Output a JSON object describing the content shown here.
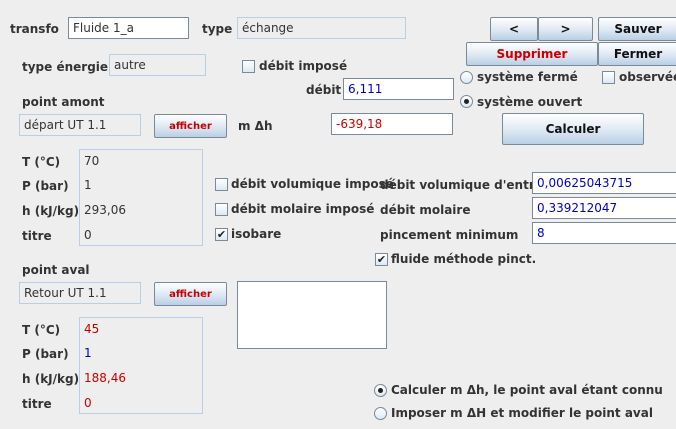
{
  "header": {
    "transfo_label": "transfo",
    "transfo_value": "Fluide 1_a",
    "type_label": "type",
    "type_value": "échange"
  },
  "nav": {
    "prev_label": "<",
    "next_label": ">",
    "save_label": "Sauver",
    "delete_label": "Supprimer",
    "close_label": "Fermer"
  },
  "energy": {
    "label": "type énergie",
    "value": "autre"
  },
  "flow": {
    "debit_impose_label": "débit imposé",
    "debit_label": "débit",
    "debit_value": "6,111",
    "m_dh_label": "m Δh",
    "m_dh_value": "-639,18"
  },
  "system": {
    "closed_label": "système fermé",
    "open_label": "système ouvert",
    "observed_label": "observée",
    "calc_label": "Calculer",
    "selected": "open"
  },
  "amont": {
    "title": "point amont",
    "name_value": "départ UT 1.1",
    "show_label": "afficher",
    "t_label": "T (°C)",
    "t_value": "70",
    "p_label": "P (bar)",
    "p_value": "1",
    "h_label": "h (kJ/kg)",
    "h_value": "293,06",
    "titre_label": "titre",
    "titre_value": "0"
  },
  "options": {
    "vol_impose_label": "débit volumique imposé",
    "mol_impose_label": "débit molaire imposé",
    "isobare_label": "isobare",
    "isobare_checked": true,
    "vol_in_label": "débit volumique d'entrée",
    "vol_in_value": "0,00625043715",
    "mol_label": "débit molaire",
    "mol_value": "0,339212047",
    "pinch_label": "pincement minimum",
    "pinch_value": "8",
    "fluid_pinch_label": "fluide méthode pinct.",
    "fluid_pinch_checked": true
  },
  "aval": {
    "title": "point aval",
    "name_value": "Retour UT 1.1",
    "show_label": "afficher",
    "t_label": "T (°C)",
    "t_value": "45",
    "p_label": "P (bar)",
    "p_value": "1",
    "h_label": "h (kJ/kg)",
    "h_value": "188,46",
    "titre_label": "titre",
    "titre_value": "0"
  },
  "mode": {
    "option1_label": "Calculer m Δh, le point aval étant connu",
    "option2_label": "Imposer m ΔH et modifier le point aval",
    "selected": 1
  },
  "colors": {
    "computed_red": "#cc0000",
    "input_blue": "#0000cc",
    "button_gradient_end": "#b8cfe5"
  }
}
